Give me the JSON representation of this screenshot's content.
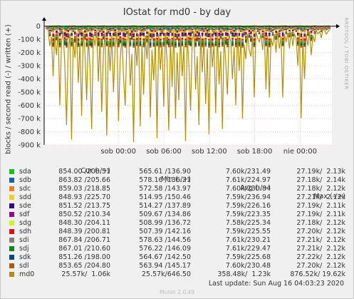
{
  "title": "IOstat for md0 - by day",
  "side_credit": "RRDTOOL / TOBI OETIKER",
  "footer": {
    "last_update": "Last update: Sun Aug 16 04:03:23 2020",
    "version": "Munin 2.0.49"
  },
  "legend_header": {
    "cur": "Cur (-/+)",
    "min": "Min (-/+)",
    "avg": "Avg (-/+)",
    "max": "Max (-/+)"
  },
  "legend": [
    {
      "name": "sda",
      "color": "#00cc00",
      "cur": "854.00 /208.51",
      "min": "565.61 /136.90",
      "avg": "7.60k/231.49",
      "max": "27.19k/  2.13k"
    },
    {
      "name": "sdb",
      "color": "#0066b3",
      "cur": "863.82 /205.66",
      "min": "578.16 /136.21",
      "avg": "7.61k/224.97",
      "max": "27.18k/  2.14k"
    },
    {
      "name": "sdc",
      "color": "#ff8000",
      "cur": "859.03 /218.85",
      "min": "572.58 /143.97",
      "avg": "7.60k/230.84",
      "max": "27.18k/  2.12k"
    },
    {
      "name": "sdd",
      "color": "#ffcc00",
      "cur": "848.93 /225.70",
      "min": "514.95 /150.46",
      "avg": "7.59k/236.94",
      "max": "27.21k/  2.12k"
    },
    {
      "name": "sde",
      "color": "#330099",
      "cur": "851.52 /213.75",
      "min": "514.27 /137.89",
      "avg": "7.59k/226.16",
      "max": "27.19k/  2.11k"
    },
    {
      "name": "sdf",
      "color": "#990099",
      "cur": "850.52 /210.34",
      "min": "509.67 /134.86",
      "avg": "7.59k/223.35",
      "max": "27.19k/  2.11k"
    },
    {
      "name": "sdg",
      "color": "#ccff00",
      "cur": "848.30 /204.11",
      "min": "508.99 /136.72",
      "avg": "7.58k/225.34",
      "max": "27.18k/  2.12k"
    },
    {
      "name": "sdh",
      "color": "#ff0000",
      "cur": "848.39 /200.81",
      "min": "507.39 /142.16",
      "avg": "7.59k/225.55",
      "max": "27.20k/  2.12k"
    },
    {
      "name": "sdi",
      "color": "#808080",
      "cur": "867.84 /206.71",
      "min": "578.63 /144.56",
      "avg": "7.61k/230.21",
      "max": "27.21k/  2.12k"
    },
    {
      "name": "sdj",
      "color": "#008f00",
      "cur": "867.01 /210.60",
      "min": "576.22 /146.09",
      "avg": "7.61k/229.47",
      "max": "27.21k/  2.12k"
    },
    {
      "name": "sdk",
      "color": "#00487d",
      "cur": "851.26 /198.00",
      "min": "564.67 /142.50",
      "avg": "7.59k/225.68",
      "max": "27.22k/  2.12k"
    },
    {
      "name": "sdl",
      "color": "#b35a00",
      "cur": "853.65 /204.80",
      "min": "563.94 /145.17",
      "avg": "7.60k/230.48",
      "max": "27.20k/  2.12k"
    },
    {
      "name": "md0",
      "color": "#b38f00",
      "cur": "  25.57k/  1.06k",
      "min": "  25.57k/646.50",
      "avg": "358.48k/  1.23k",
      "max": "876.52k/ 19.62k"
    }
  ],
  "chart_data": {
    "type": "line",
    "title": "IOstat for md0 - by day",
    "ylabel": "blocks / second read (-) / written (+)",
    "y_ticks": [
      "0",
      "-100 k",
      "-200 k",
      "-300 k",
      "-400 k",
      "-500 k",
      "-600 k",
      "-700 k",
      "-800 k",
      "-900 k"
    ],
    "x_ticks": [
      "sob 00:00",
      "sob 06:00",
      "sob 12:00",
      "sob 18:00",
      "nie 00:00"
    ],
    "ylim": [
      -900000,
      20000
    ],
    "x_range_hours": [
      -9.8,
      28.2
    ],
    "x_tick_hours": [
      0,
      6,
      12,
      18,
      24
    ],
    "grid": true,
    "md0_read_samples": [
      -20000,
      -25000,
      -150000,
      -80000,
      -380000,
      -60000,
      -220000,
      -45000,
      -600000,
      -120000,
      -40000,
      -300000,
      -750000,
      -180000,
      -60000,
      -860000,
      -90000,
      -240000,
      -50000,
      -430000,
      -130000,
      -680000,
      -40000,
      -200000,
      -560000,
      -80000,
      -310000,
      -780000,
      -60000,
      -150000,
      -30000,
      -420000,
      -90000,
      -650000,
      -200000,
      -50000,
      -830000,
      -110000,
      -340000,
      -70000,
      -500000,
      -160000,
      -40000,
      -720000,
      -260000,
      -80000,
      -380000,
      -600000,
      -120000,
      -30000,
      -450000,
      -210000,
      -880000,
      -90000,
      -300000,
      -60000,
      -760000,
      -140000,
      -520000,
      -70000,
      -250000,
      -40000,
      -690000,
      -180000,
      -410000,
      -90000,
      -850000,
      -60000,
      -330000,
      -120000,
      -610000,
      -50000,
      -270000,
      -790000,
      -100000,
      -460000,
      -30000,
      -700000,
      -200000,
      -560000,
      -80000,
      -380000,
      -150000,
      -870000,
      -60000,
      -290000,
      -640000,
      -110000,
      -40000,
      -480000,
      -230000,
      -750000,
      -70000,
      -350000,
      -90000,
      -590000,
      -170000,
      -820000,
      -50000,
      -310000,
      -130000,
      -660000,
      -40000,
      -440000,
      -190000,
      -780000,
      -80000,
      -270000,
      -520000,
      -60000,
      -120000,
      -400000,
      -160000,
      -600000,
      -50000,
      -340000,
      -90000,
      -700000,
      -140000,
      -250000,
      -60000,
      -180000,
      -230000,
      -80000,
      -540000,
      -40000,
      -90000,
      -120000,
      -60000,
      -180000,
      -30000,
      -480000,
      -70000,
      -540000,
      -90000,
      -150000,
      -60000,
      -200000,
      -40000,
      -170000,
      -80000,
      -540000,
      -60000,
      -120000,
      -50000,
      -170000,
      -40000,
      -150000,
      -60000,
      -90000,
      -300000,
      -50000,
      -700000,
      -80000,
      -400000,
      -60000,
      -150000,
      -40000,
      -220000,
      -70000,
      -120000,
      -30000,
      -60000,
      -40000,
      -90000,
      -20000,
      -30000,
      -60000,
      -40000,
      -30000
    ]
  }
}
